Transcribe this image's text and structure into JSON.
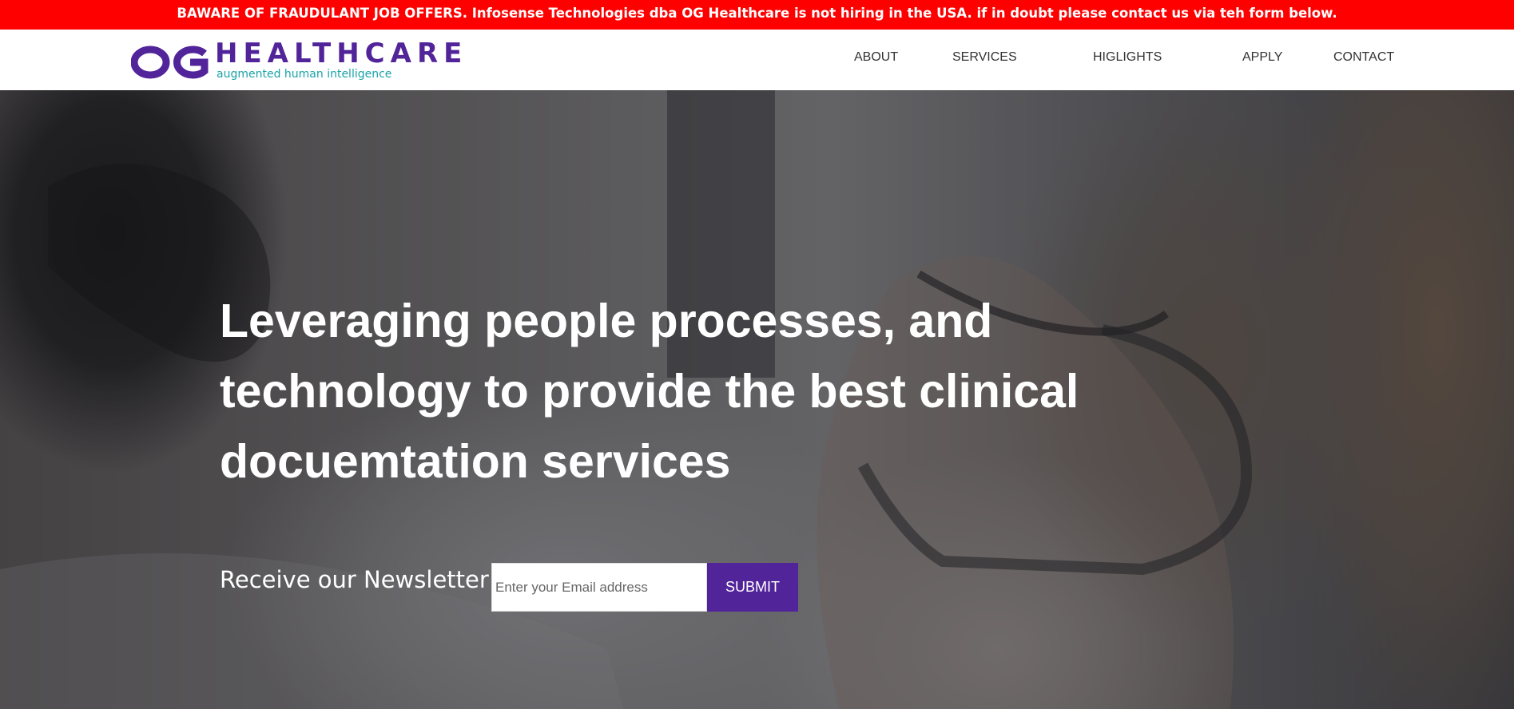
{
  "alert": {
    "text": "BAWARE OF FRAUDULANT JOB OFFERS. Infosense Technologies dba OG Healthcare is not hiring in the USA. if in doubt please contact us via teh form below.",
    "bg_color": "#ff0000"
  },
  "header": {
    "logo": {
      "mark": "OG",
      "wordmark": "HEALTHCARE",
      "tagline": "augmented human intelligence",
      "brand_color": "#52249a",
      "tagline_color": "#19a3a8"
    },
    "nav": [
      "ABOUT",
      "SERVICES",
      "HIGLIGHTS",
      "APPLY",
      "CONTACT"
    ]
  },
  "hero": {
    "title": "Leveraging people processes, and technology to provide the best clinical docuemtation services",
    "newsletter": {
      "label": "Receive our Newsletter",
      "email_placeholder": "Enter your Email address",
      "email_value": "",
      "submit_label": "SUBMIT"
    }
  }
}
